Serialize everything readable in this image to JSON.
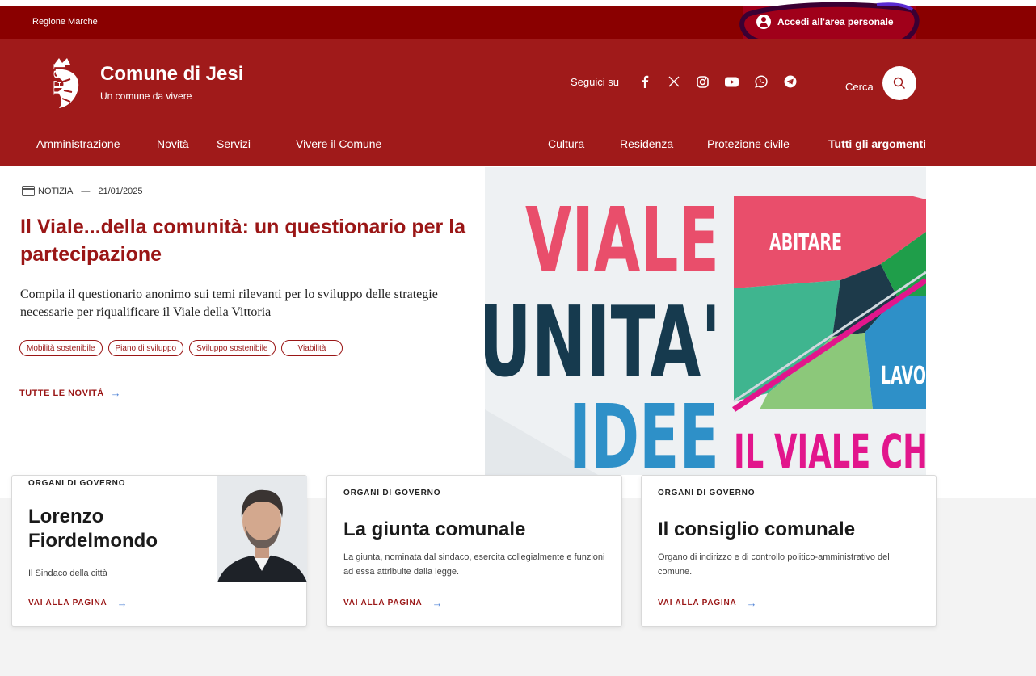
{
  "topbar": {
    "region": "Regione Marche",
    "login_label": "Accedi all'area personale"
  },
  "header": {
    "logo_text": "JESI",
    "title": "Comune di Jesi",
    "subtitle": "Un comune da vivere",
    "follow_label": "Seguici su",
    "social_icons": [
      "facebook-icon",
      "x-icon",
      "instagram-icon",
      "youtube-icon",
      "whatsapp-icon",
      "telegram-icon"
    ],
    "search_label": "Cerca"
  },
  "nav": {
    "items": [
      "Amministrazione",
      "Novità",
      "Servizi",
      "Vivere il Comune"
    ],
    "secondary": [
      "Cultura",
      "Residenza",
      "Protezione civile",
      "Tutti gli argomenti"
    ]
  },
  "hero": {
    "type": "NOTIZIA",
    "date": "21/01/2025",
    "title": "Il Viale...della comunità: un questionario per la partecipazione",
    "description": "Compila il questionario anonimo sui temi rilevanti per lo sviluppo delle strategie necessarie per riqualificare il Viale della Vittoria",
    "tags": [
      "Mobilità sostenibile",
      "Piano di sviluppo",
      "Sviluppo sostenibile",
      "Viabilità"
    ],
    "all_news": "TUTTE LE NOVITÀ",
    "image_text": {
      "line1": "VIALE",
      "line2": "UNITA'",
      "line3": "IDEE",
      "abitare": "ABITARE",
      "lavoro": "LAVO",
      "bottom": "IL VIALE CH"
    }
  },
  "cards": [
    {
      "kicker": "ORGANI DI GOVERNO",
      "title": "Lorenzo Fiordelmondo",
      "description": "Il Sindaco della città",
      "link": "VAI ALLA PAGINA"
    },
    {
      "kicker": "ORGANI DI GOVERNO",
      "title": "La giunta comunale",
      "description": "La giunta, nominata dal sindaco, esercita collegialmente e funzioni ad essa attribuite dalla legge.",
      "link": "VAI ALLA PAGINA"
    },
    {
      "kicker": "ORGANI DI GOVERNO",
      "title": "Il consiglio comunale",
      "description": "Organo di indirizzo e di controllo politico-amministrativo del comune.",
      "link": "VAI ALLA PAGINA"
    }
  ],
  "colors": {
    "topbar": "#8a0000",
    "header": "#a01a1a",
    "accent": "#9a1616",
    "link_arrow": "#4a7fd4"
  }
}
